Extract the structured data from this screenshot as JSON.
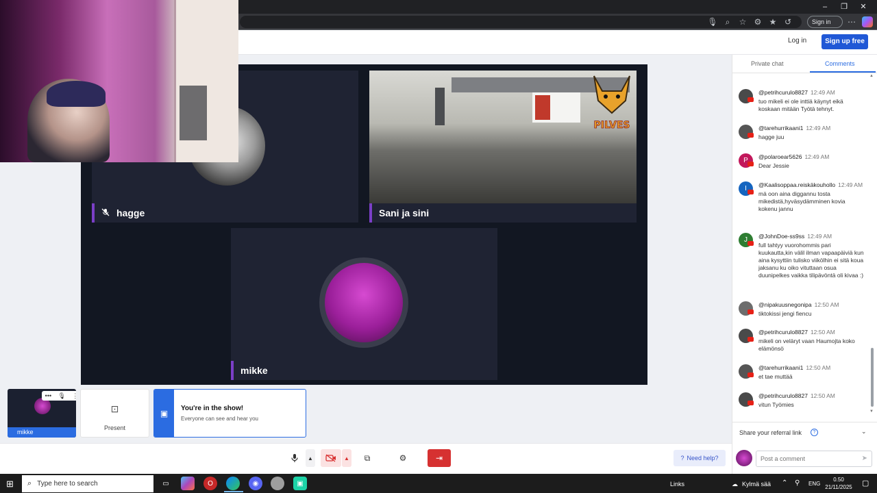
{
  "browser": {
    "signin_label": "Sign in",
    "window_controls": [
      "–",
      "❐",
      "✕"
    ]
  },
  "header": {
    "login_label": "Log in",
    "signup_label": "Sign up free"
  },
  "stage": {
    "participants": [
      {
        "name": "hagge",
        "muted": true
      },
      {
        "name": "Sani ja sini",
        "muted": false
      },
      {
        "name": "mikke",
        "muted": false
      }
    ],
    "brand_logo_text": "PILVES"
  },
  "bottom_strip": {
    "self_name": "mikke",
    "present_label": "Present",
    "toast_title": "You're in the show!",
    "toast_body": "Everyone can see and hear you"
  },
  "controls": {
    "help_label": "Need help?"
  },
  "panel": {
    "tab_private": "Private chat",
    "tab_comments": "Comments",
    "comments": [
      {
        "user": "@petrihcurulo8827",
        "time": "12:49 AM",
        "text": "tuo mikeli ei ole inttiä käynyt eikä koskaan mitään Työtä tehnyt.",
        "avatar_letter": "",
        "avatar_color": "#4a4a4a"
      },
      {
        "user": "@tarehurrikaani1",
        "time": "12:49 AM",
        "text": "hagge juu",
        "avatar_letter": "",
        "avatar_color": "#555555"
      },
      {
        "user": "@polaroear5626",
        "time": "12:49 AM",
        "text": "Dear Jessie",
        "avatar_letter": "P",
        "avatar_color": "#c2185b"
      },
      {
        "user": "@Kaalisoppaa.reiskäkouhollo",
        "time": "12:49 AM",
        "text": "mä oon aina diggannu tosta mikedistä,hyväsydämminen kovia kokenu jannu",
        "avatar_letter": "I",
        "avatar_color": "#1565c0"
      },
      {
        "user": "@JohnDoe-ss9ss",
        "time": "12:49 AM",
        "text": "full tahtyy vuorohommis pari kuukautta,kin välil ilman vapaapäiviä kun aina kysyttiin tulisko viikölhin ei sitä koua jaksanu ku oiko vituttaan osua duunipelkes vaikka tilipävöntä oli kivaa :)",
        "avatar_letter": "J",
        "avatar_color": "#2e7d32"
      },
      {
        "user": "@nipakuusnegonipa",
        "time": "12:50 AM",
        "text": "tiktokissi jengi fiencu",
        "avatar_letter": "",
        "avatar_color": "#6d6d6d"
      },
      {
        "user": "@petrihcurulo8827",
        "time": "12:50 AM",
        "text": "mikeli on veläryt vaan Haumojta koko elämönsö",
        "avatar_letter": "",
        "avatar_color": "#4a4a4a"
      },
      {
        "user": "@tarehurrikaani1",
        "time": "12:50 AM",
        "text": "et tae muttää",
        "avatar_letter": "",
        "avatar_color": "#555555"
      },
      {
        "user": "@petrihcurulo8827",
        "time": "12:50 AM",
        "text": "vitun Työmies",
        "avatar_letter": "",
        "avatar_color": "#4a4a4a"
      }
    ],
    "referral_label": "Share your referral link",
    "compose_placeholder": "Post a comment"
  },
  "taskbar": {
    "search_placeholder": "Type here to search",
    "links_label": "Links",
    "weather": "Kylmä sää",
    "language": "ENG",
    "time": "0.50",
    "date": "21/11/2025"
  }
}
